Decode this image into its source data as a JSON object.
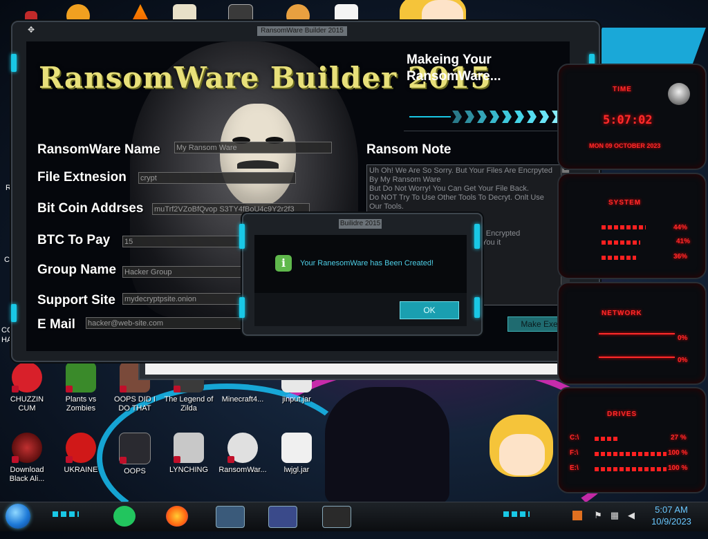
{
  "main_window": {
    "title": "RansomWare Builder 2015",
    "app_title": "RansomWare Builder 2015",
    "fields": [
      {
        "label": "RansomWare Name",
        "value": "My Ransom Ware"
      },
      {
        "label": "File Extnesion",
        "value": "crypt"
      },
      {
        "label": "Bit Coin Addrses",
        "value": "muTrf2VZoBfQvop S3TY4fBoU4c9Y2r2f3"
      },
      {
        "label": "BTC To Pay",
        "value": "15"
      },
      {
        "label": "Group Name",
        "value": "Hacker Group"
      },
      {
        "label": "Support Site",
        "value": "mydecryptpsite.onion"
      },
      {
        "label": "E Mail",
        "value": "hacker@web-site.com"
      }
    ],
    "status": "Makeing Your RansomWare...",
    "ransom_note_label": "Ransom Note",
    "ransom_note_text": "Uh Oh! We Are So Sorry. But Your Files Are Encrpyted By My Ransom Ware\nBut Do Not Worry! You Can Get Your File Back.\nDo NOT Try To Use Other Tools To Decryt. Onlt Use Our Tools.\n                                   ss:\n                                   Y2r2f3\n                                   ? Send One Encrypted\n                                    we will s    You it\n\n                                   on\n                                   ker Group",
    "make_button": "Make Exe"
  },
  "dialog": {
    "title": "Builidre 2015",
    "message": "Your RanesomWare has Been Created!",
    "ok_label": "OK",
    "icon": "info-icon"
  },
  "gadgets": {
    "time": {
      "title": "TIME",
      "clock": "5:07:02",
      "date": "MON 09 OCTOBER 2023"
    },
    "system": {
      "title": "SYSTEM",
      "cpu": "44%",
      "ram": "41%",
      "disk": "36%"
    },
    "network": {
      "title": "NETWORK",
      "up": "0%",
      "down": "0%"
    },
    "drives": {
      "title": "DRIVES",
      "items": [
        {
          "label": "C:\\",
          "value": "27 %"
        },
        {
          "label": "F:\\",
          "value": "100 %"
        },
        {
          "label": "E:\\",
          "value": "100 %"
        }
      ]
    }
  },
  "desktop_icons_row1": [
    {
      "label": "CHUZZIN CUM",
      "color": "#d8202a"
    },
    {
      "label": "Plants vs Zombies",
      "color": "#3a8a2a"
    },
    {
      "label": "OOPS DID I DO THAT",
      "color": "#7a4a3a"
    },
    {
      "label": "The Legend of Zilda",
      "color": "#3a3a3a"
    },
    {
      "label": "Minecraft4...",
      "color": "#5a8a3a"
    },
    {
      "label": "jinput.jar",
      "color": "#e8e8e8"
    }
  ],
  "desktop_icons_row2": [
    {
      "label": "Download Black Ali...",
      "color": "#6a1a1a"
    },
    {
      "label": "UKRAINE",
      "color": "#d01818"
    },
    {
      "label": "OOPS",
      "color": "#2a2a30"
    },
    {
      "label": "LYNCHING",
      "color": "#c8c8c8"
    },
    {
      "label": "RansomWar...",
      "color": "#e0e0e0"
    },
    {
      "label": "lwjgl.jar",
      "color": "#f0f0f0"
    }
  ],
  "left_edge_labels": [
    "Re",
    "Co",
    "CC",
    "HA"
  ],
  "taskbar": {
    "time": "5:07 AM",
    "date": "10/9/2023"
  }
}
